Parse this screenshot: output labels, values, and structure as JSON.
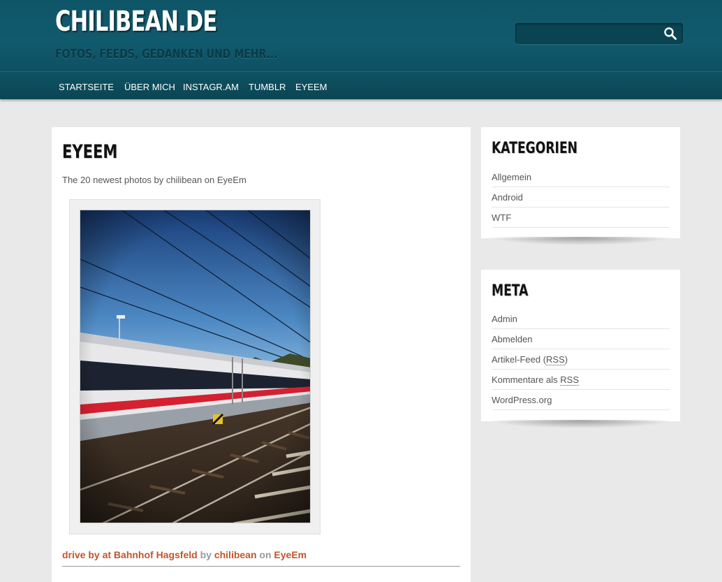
{
  "header": {
    "site_title": "CHILIBEAN.DE",
    "tagline": "FOTOS, FEEDS, GEDANKEN UND MEHR...",
    "search_placeholder": "",
    "search_icon": "search-icon"
  },
  "nav": {
    "items": [
      "STARTSEITE",
      "ÜBER MICH",
      "INSTAGR.AM",
      "TUMBLR",
      "EYEEM"
    ]
  },
  "main": {
    "title": "EYEEM",
    "intro": "The 20 newest photos by chilibean on EyeEm",
    "photo": {
      "title": "drive by at Bahnhof Hagsfeld",
      "by_word": "by",
      "author": "chilibean",
      "on_word": "on",
      "platform": "EyeEm"
    }
  },
  "sidebar": {
    "categories": {
      "title": "KATEGORIEN",
      "items": [
        "Allgemein",
        "Android",
        "WTF"
      ]
    },
    "meta": {
      "title": "META",
      "items": [
        "Admin",
        "Abmelden"
      ],
      "feed_prefix": "Artikel-Feed (",
      "feed_abbr": "RSS",
      "feed_suffix": ")",
      "comments_prefix": "Kommentare als ",
      "comments_abbr": "RSS",
      "wordpress": "WordPress.org"
    }
  },
  "colors": {
    "header_bg": "#0f5568",
    "link_accent": "#c1552b",
    "page_bg": "#e9e9e9"
  }
}
